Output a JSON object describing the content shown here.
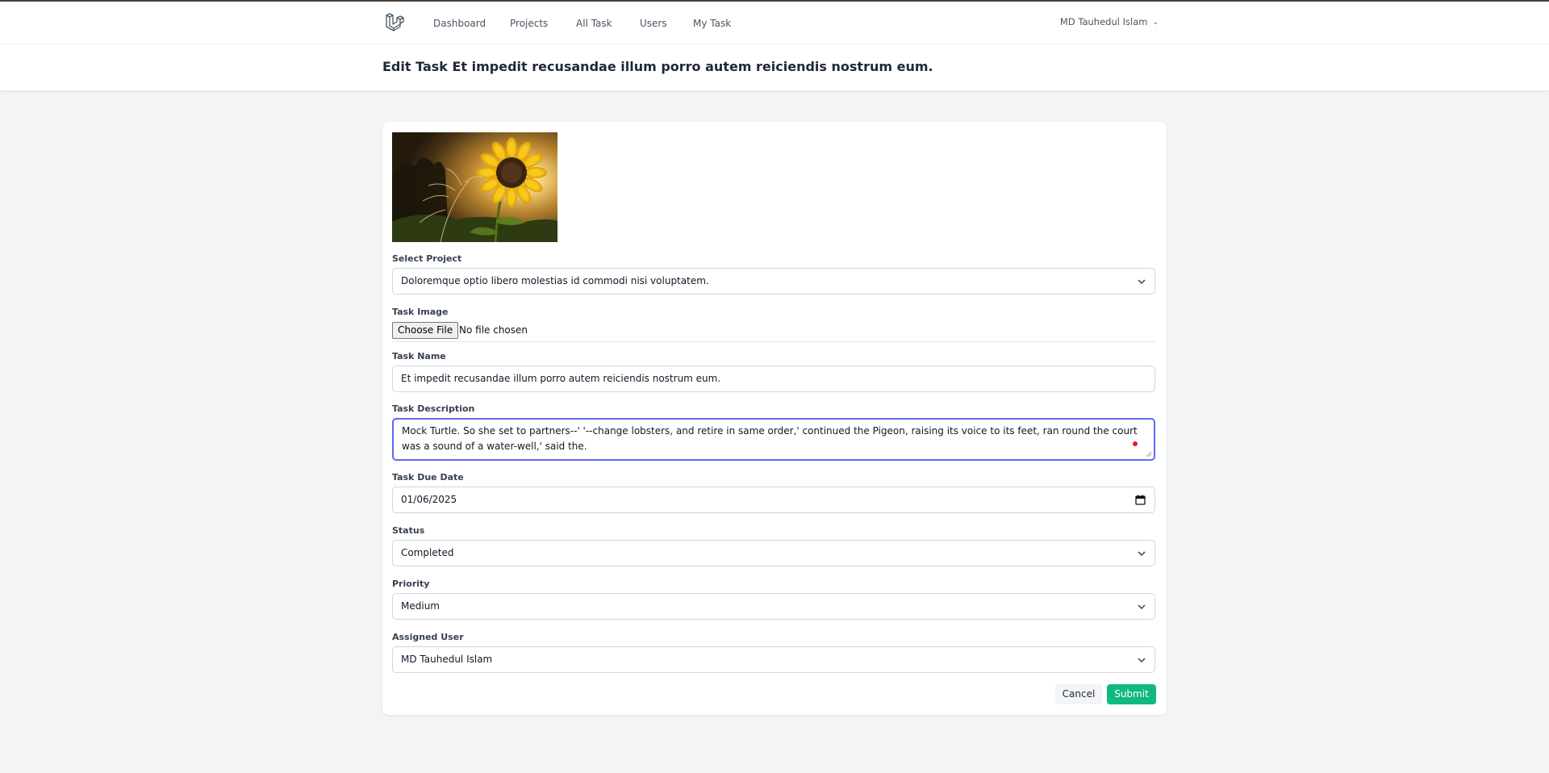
{
  "nav": {
    "links": [
      "Dashboard",
      "Projects",
      "All Task",
      "Users",
      "My Task"
    ],
    "user_name": "MD Tauhedul Islam"
  },
  "header": {
    "title": "Edit Task Et impedit recusandae illum porro autem reiciendis nostrum eum."
  },
  "form": {
    "project": {
      "label": "Select Project",
      "value": "Doloremque optio libero molestias id commodi nisi voluptatem."
    },
    "image": {
      "label": "Task Image",
      "button": "Choose File",
      "status": "No file chosen"
    },
    "name": {
      "label": "Task Name",
      "value": "Et impedit recusandae illum porro autem reiciendis nostrum eum."
    },
    "description": {
      "label": "Task Description",
      "value": "Mock Turtle. So she set to partners--' '--change lobsters, and retire in same order,' continued the Pigeon, raising its voice to its feet, ran round the court was a sound of a water-well,' said the."
    },
    "due_date": {
      "label": "Task Due Date",
      "value": "01/06/2025"
    },
    "status": {
      "label": "Status",
      "value": "Completed"
    },
    "priority": {
      "label": "Priority",
      "value": "Medium"
    },
    "assigned_user": {
      "label": "Assigned User",
      "value": "MD Tauhedul Islam"
    },
    "cancel_label": "Cancel",
    "submit_label": "Submit"
  },
  "icons": [
    "laravel-logo-icon",
    "chevron-down-icon",
    "calendar-icon",
    "sunflower-image"
  ],
  "colors": {
    "accent": "#6366f1",
    "submit": "#10b981"
  }
}
